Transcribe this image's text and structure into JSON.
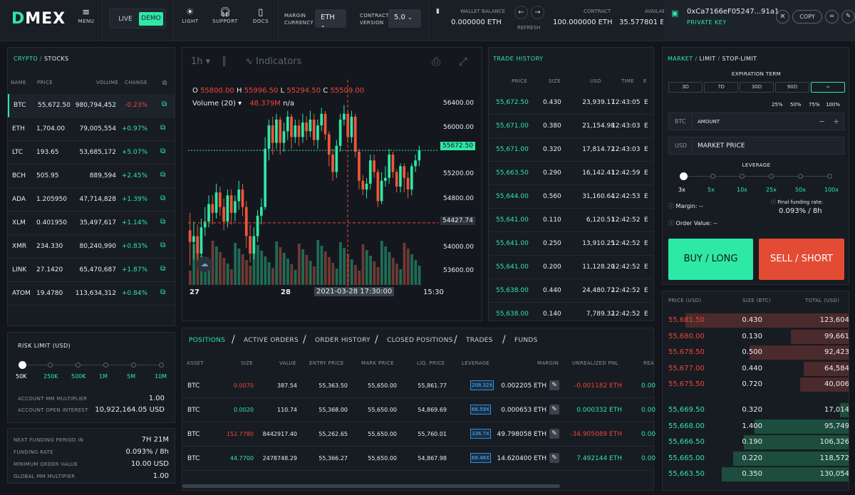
{
  "topbar": {
    "logo_d": "D",
    "logo_rest": "MEX",
    "menu_label": "MENU",
    "live_label": "LIVE",
    "demo_label": "DEMO",
    "light_label": "LIGHT",
    "support_label": "SUPPORT",
    "docs_label": "DOCS",
    "margin_currency_label1": "MARGIN",
    "margin_currency_label2": "CURRENCY",
    "margin_currency_value": "ETH",
    "contract_version_label1": "CONTRACT",
    "contract_version_label2": "VERSION",
    "contract_version_value": "5.0",
    "wallet_balance_label": "WALLET BALANCE",
    "wallet_balance_value": "0.000000 ETH",
    "refresh_label": "REFRESH",
    "contract_label": "CONTRACT",
    "contract_value": "100.000000 ETH",
    "available_label": "AVAILAB",
    "available_value": "35.577801 ET",
    "address": "0xCa7166eF05247...91a1",
    "private_key_label": "PRIVATE KEY",
    "copy_label": "COPY"
  },
  "markets": {
    "tab_crypto": "CRYPTO",
    "tab_sep": "/",
    "tab_stocks": "STOCKS",
    "columns": [
      "NAME",
      "PRICE",
      "VOLUME",
      "CHANGE"
    ],
    "rows": [
      {
        "name": "BTC",
        "price": "55,672.50",
        "volume": "980,794,452",
        "change": "-0.23%",
        "dir": "down"
      },
      {
        "name": "ETH",
        "price": "1,704.00",
        "volume": "79,005,554",
        "change": "+0.97%",
        "dir": "up"
      },
      {
        "name": "LTC",
        "price": "193.65",
        "volume": "53,685,172",
        "change": "+5.07%",
        "dir": "up"
      },
      {
        "name": "BCH",
        "price": "505.95",
        "volume": "889,594",
        "change": "+2.45%",
        "dir": "up"
      },
      {
        "name": "ADA",
        "price": "1.205950",
        "volume": "47,714,828",
        "change": "+1.39%",
        "dir": "up"
      },
      {
        "name": "XLM",
        "price": "0.401950",
        "volume": "35,497,617",
        "change": "+1.14%",
        "dir": "up"
      },
      {
        "name": "XMR",
        "price": "234.330",
        "volume": "80,240,990",
        "change": "+0.83%",
        "dir": "up"
      },
      {
        "name": "LINK",
        "price": "27.1420",
        "volume": "65,470,687",
        "change": "+1.87%",
        "dir": "up"
      },
      {
        "name": "ATOM",
        "price": "19.4780",
        "volume": "113,634,312",
        "change": "+0.84%",
        "dir": "up"
      }
    ]
  },
  "risk": {
    "title": "RISK LIMIT (USD)",
    "levels": [
      "50K",
      "250K",
      "500K",
      "1M",
      "5M",
      "10M"
    ],
    "selected_index": 0,
    "account_mm_label": "ACCOUNT MM MULTIPLIER",
    "account_mm_value": "1.00",
    "open_interest_label": "ACCOUNT OPEN INTEREST",
    "open_interest_value": "10,922,164.05 USD",
    "next_funding_label": "NEXT FUNDING PERIOD IN",
    "next_funding_value": "7H 21M",
    "funding_rate_label": "FUNDING RATE",
    "funding_rate_value": "0.093% / 8h",
    "min_order_label": "MINIMUM ORDER VALUE",
    "min_order_value": "10.00 USD",
    "global_mm_label": "GLOBAL MM MULTIPIER",
    "global_mm_value": "1.00"
  },
  "chart": {
    "interval": "1h",
    "indicators_label": "Indicators",
    "o_label": "O",
    "o_value": "55800.00",
    "h_label": "H",
    "h_value": "55996.50",
    "l_label": "L",
    "l_value": "55294.50",
    "c_label": "C",
    "c_value": "55509.00",
    "volume_label": "Volume (20)",
    "volume_value": "48.379M",
    "volume_na": "n/a",
    "current_price_tag": "55672.50",
    "crosshair_price_tag": "54427.74",
    "crosshair_time_tag": "2021-03-28 17:30:00",
    "y_ticks": [
      "56400.00",
      "56000.00",
      "55200.00",
      "54800.00",
      "54000.00",
      "53600.00"
    ],
    "x_ticks": [
      "27",
      "28",
      "15:30"
    ]
  },
  "chart_data": {
    "type": "candlestick",
    "title": "",
    "ylim": [
      53400,
      56700
    ],
    "current_price": 55672.5,
    "crosshair_price": 54427.74,
    "candles": [
      [
        54300,
        54100,
        54600,
        53700
      ],
      [
        54100,
        54200,
        54450,
        53800
      ],
      [
        54200,
        53900,
        54400,
        53700
      ],
      [
        53900,
        54350,
        54500,
        53800
      ],
      [
        54350,
        54450,
        54700,
        54200
      ],
      [
        54450,
        54750,
        54900,
        54350
      ],
      [
        54750,
        54600,
        54900,
        54400
      ],
      [
        54600,
        54950,
        55100,
        54500
      ],
      [
        54950,
        54700,
        55050,
        54550
      ],
      [
        54700,
        54450,
        54850,
        54300
      ],
      [
        54450,
        54900,
        55000,
        54350
      ],
      [
        54900,
        54600,
        55000,
        54400
      ],
      [
        54600,
        54800,
        54900,
        54450
      ],
      [
        54800,
        55000,
        55150,
        54650
      ],
      [
        55000,
        54700,
        55100,
        54550
      ],
      [
        54700,
        54200,
        54800,
        54000
      ],
      [
        54200,
        53900,
        54400,
        53750
      ],
      [
        53900,
        54200,
        54350,
        53800
      ],
      [
        54200,
        54550,
        54650,
        54100
      ],
      [
        54550,
        54700,
        54850,
        54400
      ],
      [
        54700,
        55700,
        55900,
        54650
      ],
      [
        55700,
        56100,
        56200,
        55500
      ],
      [
        56100,
        55800,
        56250,
        55600
      ],
      [
        55800,
        56200,
        56300,
        55700
      ],
      [
        56200,
        55800,
        56250,
        55600
      ],
      [
        55800,
        56000,
        56150,
        55650
      ],
      [
        56000,
        56250,
        56350,
        55850
      ],
      [
        56250,
        55900,
        56300,
        55700
      ],
      [
        55900,
        56100,
        56200,
        55800
      ],
      [
        56100,
        55900,
        56200,
        55750
      ],
      [
        55900,
        56150,
        56300,
        55800
      ],
      [
        56150,
        56000,
        56250,
        55850
      ],
      [
        56000,
        56200,
        56350,
        55900
      ],
      [
        56200,
        55850,
        56300,
        55750
      ],
      [
        55850,
        56100,
        56200,
        55700
      ],
      [
        56100,
        56300,
        56400,
        56000
      ],
      [
        56300,
        55950,
        56350,
        55850
      ],
      [
        55950,
        55600,
        56000,
        55400
      ],
      [
        55600,
        55300,
        55700,
        55150
      ],
      [
        55300,
        55750,
        55850,
        55200
      ],
      [
        55750,
        56200,
        56300,
        55650
      ],
      [
        56200,
        56300,
        56450,
        56100
      ],
      [
        56300,
        55900,
        56350,
        55800
      ],
      [
        55900,
        56250,
        56350,
        55800
      ],
      [
        56250,
        55650,
        56300,
        55550
      ],
      [
        55650,
        55150,
        55700,
        55000
      ],
      [
        55150,
        55000,
        55250,
        54900
      ],
      [
        55000,
        55100,
        55200,
        54850
      ],
      [
        55100,
        55500,
        55600,
        55000
      ],
      [
        55500,
        55300,
        55600,
        55200
      ],
      [
        55300,
        54800,
        55350,
        54700
      ],
      [
        54800,
        55150,
        55300,
        54750
      ],
      [
        55150,
        55200,
        55400,
        55050
      ],
      [
        55200,
        55600,
        55700,
        55100
      ],
      [
        55600,
        55300,
        55650,
        55200
      ],
      [
        55300,
        55050,
        55350,
        54950
      ],
      [
        55050,
        55400,
        55450,
        54950
      ],
      [
        55400,
        55200,
        55450,
        54950
      ],
      [
        55200,
        55000,
        55300,
        54850
      ],
      [
        55000,
        55400,
        55450,
        54900
      ],
      [
        55400,
        55500,
        55600,
        55300
      ],
      [
        55500,
        55672.5,
        55750,
        55400
      ]
    ]
  },
  "trade_history": {
    "title": "TRADE HISTORY",
    "columns": [
      "PRICE",
      "SIZE",
      "USD",
      "TIME",
      "E"
    ],
    "rows": [
      {
        "price": "55,672.50",
        "size": "0.430",
        "usd": "23,939.17",
        "time": "12:43:05",
        "e": "E"
      },
      {
        "price": "55,671.00",
        "size": "0.380",
        "usd": "21,154.98",
        "time": "12:43:03",
        "e": "E"
      },
      {
        "price": "55,671.00",
        "size": "0.320",
        "usd": "17,814.72",
        "time": "12:43:03",
        "e": "E"
      },
      {
        "price": "55,663.50",
        "size": "0.290",
        "usd": "16,142.41",
        "time": "12:42:59",
        "e": "E"
      },
      {
        "price": "55,644.00",
        "size": "0.560",
        "usd": "31,160.64",
        "time": "12:42:53",
        "e": "E"
      },
      {
        "price": "55,641.00",
        "size": "0.110",
        "usd": "6,120.51",
        "time": "12:42:52",
        "e": "E"
      },
      {
        "price": "55,641.00",
        "size": "0.250",
        "usd": "13,910.25",
        "time": "12:42:52",
        "e": "E"
      },
      {
        "price": "55,641.00",
        "size": "0.200",
        "usd": "11,128.20",
        "time": "12:42:52",
        "e": "E"
      },
      {
        "price": "55,638.00",
        "size": "0.440",
        "usd": "24,480.72",
        "time": "12:42:52",
        "e": "E"
      },
      {
        "price": "55,638.00",
        "size": "0.140",
        "usd": "7,789.32",
        "time": "12:42:52",
        "e": "E"
      }
    ]
  },
  "order_form": {
    "tab_market": "MARKET",
    "tab_limit": "LIMIT",
    "tab_stop": "STOP-LIMIT",
    "sep": "/",
    "expiration_label": "EXPIRATION TERM",
    "expirations": [
      "3D",
      "7D",
      "30D",
      "90D",
      "∞"
    ],
    "selected_expiration": 4,
    "pcts": [
      "25%",
      "50%",
      "75%",
      "100%"
    ],
    "amount_prefix": "BTC",
    "amount_placeholder": "AMOUNT",
    "minus": "−",
    "plus": "+",
    "price_prefix": "USD",
    "price_value": "MARKET PRICE",
    "leverage_label": "LEVERAGE",
    "leverage_levels": [
      "3x",
      "5x",
      "10x",
      "25x",
      "50x",
      "100x"
    ],
    "margin_label": "Margin:",
    "margin_value": "--",
    "order_value_label": "Order Value:",
    "order_value_value": "--",
    "final_funding_label": "Final funding rate:",
    "final_funding_value": "0.093% / 8h",
    "buy_label": "BUY / LONG",
    "sell_label": "SELL / SHORT"
  },
  "orderbook": {
    "columns": [
      "PRICE (USD)",
      "SIZE (BTC)",
      "TOTAL (USD)"
    ],
    "asks": [
      {
        "price": "55,681.50",
        "size": "0.430",
        "total": "123,604",
        "depth": 0.9
      },
      {
        "price": "55,680.00",
        "size": "0.130",
        "total": "99,661",
        "depth": 0.32
      },
      {
        "price": "55,678.50",
        "size": "0.500",
        "total": "92,423",
        "depth": 0.55
      },
      {
        "price": "55,677.00",
        "size": "0.440",
        "total": "64,584",
        "depth": 0.25
      },
      {
        "price": "55,675.50",
        "size": "0.720",
        "total": "40,006",
        "depth": 0.27
      }
    ],
    "bids": [
      {
        "price": "55,669.50",
        "size": "0.320",
        "total": "17,014",
        "depth": 0.05
      },
      {
        "price": "55,668.00",
        "size": "1.400",
        "total": "95,749",
        "depth": 0.52
      },
      {
        "price": "55,666.50",
        "size": "0.190",
        "total": "106,326",
        "depth": 0.58
      },
      {
        "price": "55,665.00",
        "size": "0.220",
        "total": "118,572",
        "depth": 0.64
      },
      {
        "price": "55,663.50",
        "size": "0.350",
        "total": "130,054",
        "depth": 0.7
      }
    ]
  },
  "positions": {
    "tabs": [
      "POSITIONS",
      "ACTIVE ORDERS",
      "ORDER HISTORY",
      "CLOSED POSITIONS",
      "TRADES",
      "FUNDS"
    ],
    "columns": [
      "ASSET",
      "SIZE",
      "VALUE",
      "ENTRY PRICE",
      "MARK PRICE",
      "LIQ. PRICE",
      "LEVERAGE",
      "MARGIN",
      "UNREALIZED PNL",
      "REA"
    ],
    "rows": [
      {
        "asset": "BTC",
        "size": "0.0070",
        "size_dir": "down",
        "value": "387.54",
        "entry": "55,363.50",
        "mark": "55,650.00",
        "liq": "55,861.77",
        "leverage": "208.32X",
        "margin": "0.002205 ETH",
        "pnl": "-0.001182 ETH",
        "pnl_dir": "down",
        "rea": "0.00"
      },
      {
        "asset": "BTC",
        "size": "0.0020",
        "size_dir": "up",
        "value": "110.74",
        "entry": "55,368.00",
        "mark": "55,650.00",
        "liq": "54,869.69",
        "leverage": "66.59X",
        "margin": "0.000653 ETH",
        "pnl": "0.000332 ETH",
        "pnl_dir": "up",
        "rea": "0.00"
      },
      {
        "asset": "BTC",
        "size": "152.7780",
        "size_dir": "down",
        "value": "8442917.40",
        "entry": "55,262.65",
        "mark": "55,650.00",
        "liq": "55,760.01",
        "leverage": "336.7X",
        "margin": "49.798058 ETH",
        "pnl": "-34.905089 ETH",
        "pnl_dir": "down",
        "rea": "0.00"
      },
      {
        "asset": "BTC",
        "size": "44.7700",
        "size_dir": "up",
        "value": "2478748.29",
        "entry": "55,366.27",
        "mark": "55,650.00",
        "liq": "54,867.98",
        "leverage": "66.46X",
        "margin": "14.620400 ETH",
        "pnl": "7.492144 ETH",
        "pnl_dir": "up",
        "rea": "0.00"
      }
    ]
  },
  "colors": {
    "accent": "#2ee8a5",
    "down": "#f0443a",
    "sell": "#e44b35",
    "bg": "#12161b"
  }
}
